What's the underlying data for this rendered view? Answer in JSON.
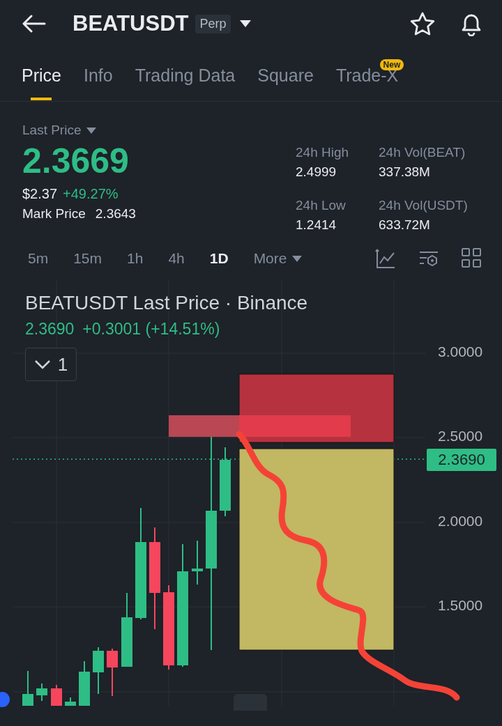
{
  "header": {
    "symbol": "BEATUSDT",
    "badge": "Perp"
  },
  "tabs": [
    {
      "label": "Price",
      "selected": true
    },
    {
      "label": "Info",
      "selected": false
    },
    {
      "label": "Trading Data",
      "selected": false
    },
    {
      "label": "Square",
      "selected": false
    },
    {
      "label": "Trade-X",
      "selected": false,
      "badge": "New"
    }
  ],
  "last_price": {
    "label": "Last Price",
    "value": "2.3669",
    "usd": "$2.37",
    "change": "+49.27%",
    "mark_label": "Mark Price",
    "mark_value": "2.3643"
  },
  "stats": [
    {
      "label": "24h High",
      "value": "2.4999"
    },
    {
      "label": "24h Vol(BEAT)",
      "value": "337.38M"
    },
    {
      "label": "24h Low",
      "value": "1.2414"
    },
    {
      "label": "24h Vol(USDT)",
      "value": "633.72M"
    }
  ],
  "intervals": [
    {
      "label": "5m",
      "selected": false
    },
    {
      "label": "15m",
      "selected": false
    },
    {
      "label": "1h",
      "selected": false
    },
    {
      "label": "4h",
      "selected": false
    },
    {
      "label": "1D",
      "selected": true
    }
  ],
  "more": "More",
  "chart": {
    "title": "BEATUSDT Last Price · Binance",
    "price": "2.3690",
    "change": "+0.3001 (+14.51%)",
    "collapse_count": "1",
    "price_axis": [
      "3.0000",
      "2.5000",
      "2.0000",
      "1.5000"
    ],
    "current_price_tag": "2.3690"
  }
}
